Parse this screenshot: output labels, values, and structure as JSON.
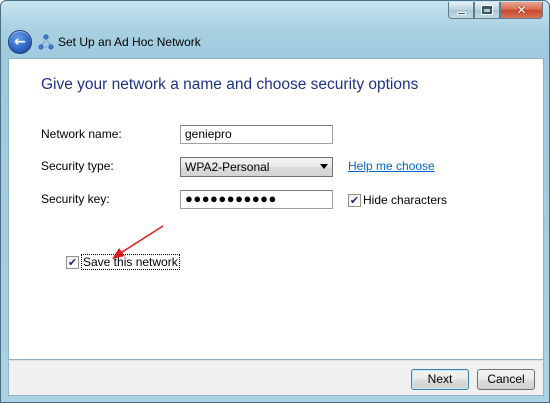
{
  "window": {
    "title": "Set Up an Ad Hoc Network",
    "caption_buttons": {
      "close_glyph": "✕"
    },
    "back_icon": "back-arrow-icon",
    "network_icon": "adhoc-network-icon"
  },
  "page": {
    "heading": "Give your network a name and choose security options"
  },
  "form": {
    "network_name_label": "Network name:",
    "network_name_value": "geniepro",
    "security_type_label": "Security type:",
    "security_type_value": "WPA2-Personal",
    "help_link": "Help me choose",
    "security_key_label": "Security key:",
    "security_key_value": "●●●●●●●●●●●",
    "hide_characters_label": "Hide characters",
    "hide_characters_checked": true,
    "save_network_label": "Save this network",
    "save_network_checked": true
  },
  "annotation": {
    "arrow_color": "#e02020"
  },
  "footer": {
    "next_label": "Next",
    "cancel_label": "Cancel"
  },
  "colors": {
    "heading": "#1e3287",
    "link": "#0066cc"
  }
}
